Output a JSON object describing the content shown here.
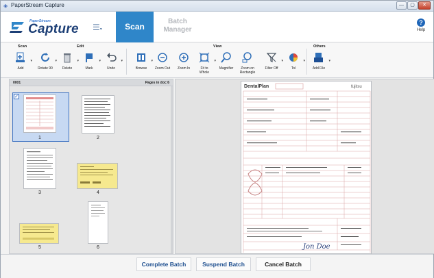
{
  "window": {
    "title": "PaperStream Capture",
    "controls": [
      "—",
      "▢",
      "✕"
    ]
  },
  "header": {
    "brand_small": "PaperStream",
    "brand": "Capture",
    "tabs": {
      "scan": "Scan",
      "batch_line1": "Batch",
      "batch_line2": "Manager"
    },
    "help": "Help"
  },
  "ribbon": {
    "groups": {
      "scan": "Scan",
      "edit": "Edit",
      "view": "View",
      "others": "Others"
    },
    "tools": {
      "add": "Add",
      "rotate": "Rotate 90",
      "delete": "Delete",
      "mark": "Mark",
      "undo": "Undo",
      "browse": "Browse",
      "zoom_out": "Zoom Out",
      "zoom_in": "Zoom In",
      "fit_line1": "Fit to",
      "fit_line2": "Whole",
      "magnifier": "Magnifier",
      "zoom_rect_line1": "Zoom on",
      "zoom_rect_line2": "Rectangle",
      "filter": "Filter Off",
      "tool": "Tol",
      "add_file": "Add File"
    }
  },
  "left_pane": {
    "head_left": "0001",
    "head_right": "Pages in doc:6",
    "thumbnails": [
      "1",
      "2",
      "3",
      "4",
      "5",
      "6"
    ]
  },
  "document": {
    "company": "DentalPlan",
    "vendor": "fujitsu",
    "signature": "Jon Doe"
  },
  "footer": {
    "complete": "Complete Batch",
    "suspend": "Suspend Batch",
    "cancel": "Cancel Batch"
  }
}
